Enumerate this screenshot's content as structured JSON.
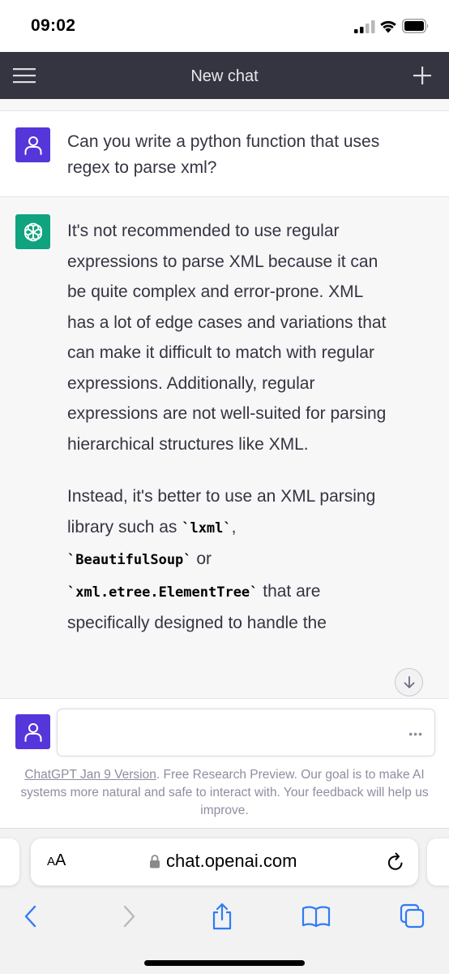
{
  "status_bar": {
    "time": "09:02"
  },
  "header": {
    "title": "New chat"
  },
  "conversation": {
    "user_message": "Can you write a python function that uses regex to parse xml?",
    "assistant_paragraph_1": "It's not recommended to use regular expressions to parse XML because it can be quite complex and error-prone. XML has a lot of edge cases and variations that can make it difficult to match with regular expressions. Additionally, regular expressions are not well-suited for parsing hierarchical structures like XML.",
    "assistant_paragraph_2": {
      "intro": "Instead, it's better to use an XML parsing library such as ",
      "code_1": "`lxml`",
      "sep_1": ",",
      "code_2": "`BeautifulSoup`",
      "sep_2": " or",
      "code_3": "`xml.etree.ElementTree`",
      "tail": " that are specifically designed to handle the"
    }
  },
  "input": {
    "placeholder": "",
    "more_icon": "ellipsis-icon"
  },
  "disclaimer": {
    "link_text": "ChatGPT Jan 9 Version",
    "text": ". Free Research Preview. Our goal is to make AI systems more natural and safe to interact with. Your feedback will help us improve."
  },
  "browser": {
    "aa_label_small": "A",
    "aa_label_large": "A",
    "url": "chat.openai.com"
  },
  "colors": {
    "header_bg": "#343541",
    "user_avatar": "#5436da",
    "assistant_avatar": "#10a37f",
    "assistant_bg": "#f7f7f8",
    "browser_accent": "#2f7bf6"
  }
}
